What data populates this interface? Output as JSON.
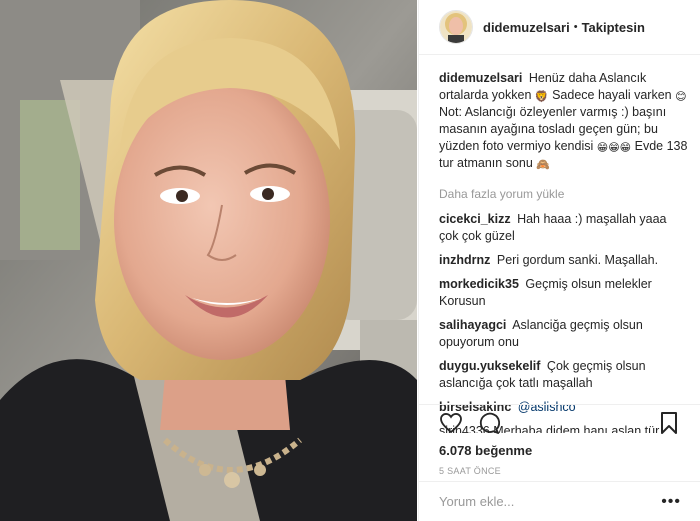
{
  "post": {
    "username": "didemuzelsari",
    "dot": "•",
    "follow_label": "Takiptesin",
    "caption": {
      "username": "didemuzelsari",
      "part1": "Henüz daha Aslancık ortalarda yokken",
      "emoji1": "🦁",
      "part2": "Sadece hayali varken",
      "emoji2": "😊",
      "part3": "Not: Aslancığı özleyenler varmış :) başını masanın ayağına tosladı geçen gün; bu yüzden foto vermiyo kendisi",
      "emoji3": "😁😁😁",
      "part4": "Evde 138 tur atmanın sonu",
      "emoji4": "🙈"
    },
    "load_more": "Daha fazla yorum yükle",
    "comments": [
      {
        "user": "cicekci_kizz",
        "text": "Hah haaa :) maşallah yaaa çok çok güzel"
      },
      {
        "user": "inzhdrnz",
        "text": "Peri gordum sanki. Maşallah."
      },
      {
        "user": "morkedicik35",
        "text": "Geçmiş olsun melekler Korusun"
      },
      {
        "user": "salihayagci",
        "text": "Aslanciğa geçmiş olsun opuyorum onu"
      },
      {
        "user": "duygu.yuksekelif",
        "text": "Çok geçmiş olsun aslancığa çok tatlı maşallah"
      },
      {
        "user": "birselsakinc",
        "text": "@aslishco"
      }
    ],
    "cut_comment": "sirin4336 Merhaba didem hanı aslan tür",
    "likes": "6.078 beğenme",
    "time": "5 SAAT ÖNCE",
    "comment_placeholder": "Yorum ekle...",
    "more_options": "•••"
  },
  "icons": {
    "like": "heart-icon",
    "comment": "comment-icon",
    "save": "bookmark-icon",
    "more": "more-options-icon"
  },
  "colors": {
    "text": "#262626",
    "muted": "#999999",
    "mention": "#003569",
    "border": "#efefef"
  }
}
